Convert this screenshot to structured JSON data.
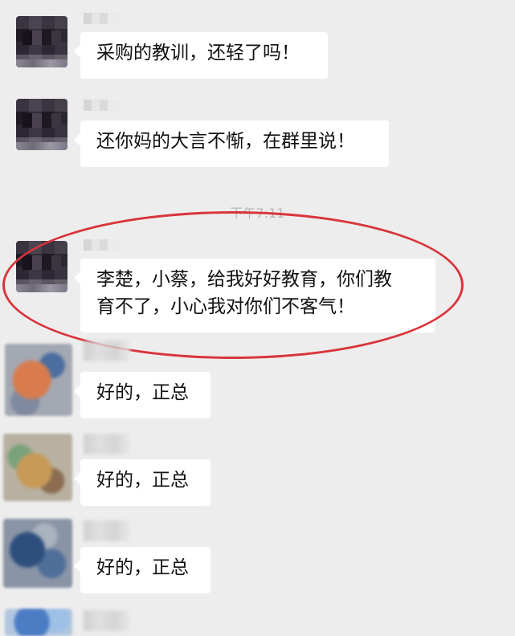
{
  "colors": {
    "background": "#ededed",
    "bubble": "#ffffff",
    "text": "#111111",
    "timestamp": "#b7b7b7",
    "annotation_circle": "#d9343b"
  },
  "timestamp": "下午7:11",
  "messages": [
    {
      "text": "采购的教训，还轻了吗！"
    },
    {
      "text": "还你妈的大言不惭，在群里说！"
    },
    {
      "text_line1": "李楚，小蔡，给我好好教育，你们教",
      "text_line2": "育不了，小心我对你们不客气！"
    },
    {
      "text": "好的，正总"
    },
    {
      "text": "好的，正总"
    },
    {
      "text": "好的，正总"
    }
  ]
}
